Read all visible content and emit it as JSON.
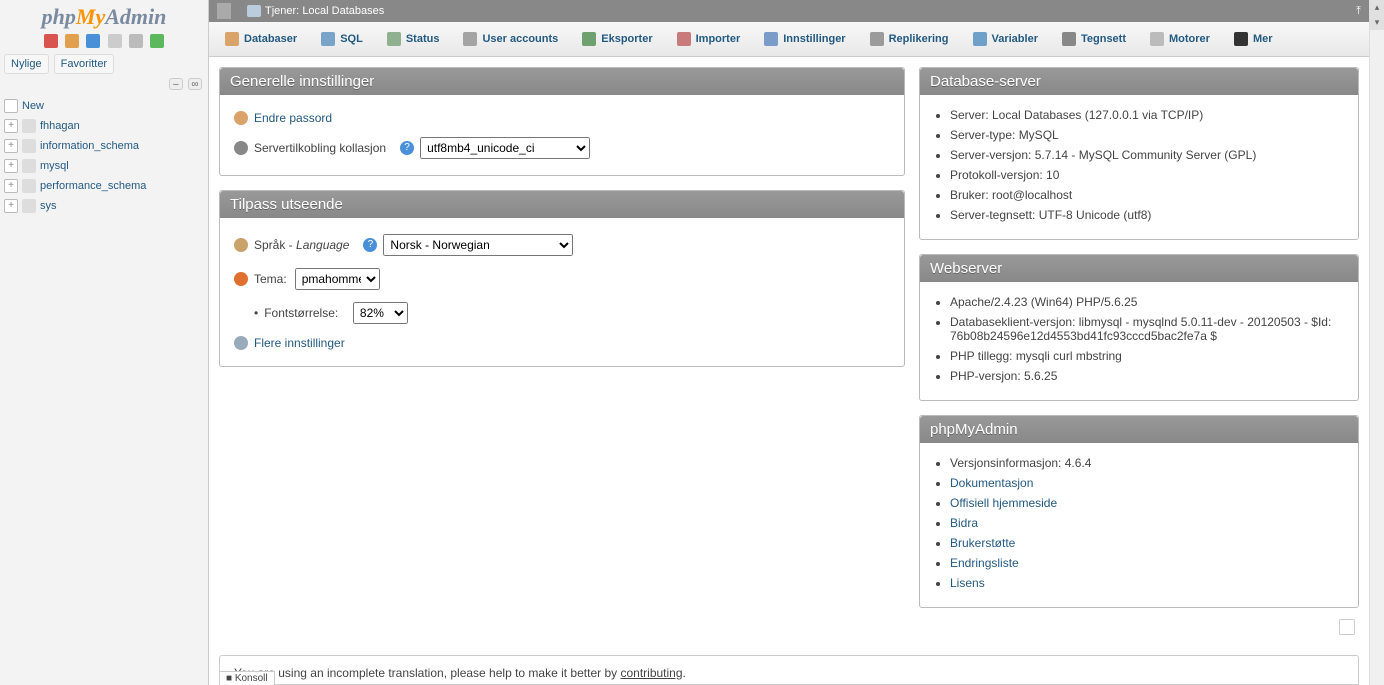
{
  "logo": {
    "p1": "php",
    "p2": "My",
    "p3": "Admin"
  },
  "navTabs": {
    "recent": "Nylige",
    "fav": "Favoritter"
  },
  "tree": {
    "new": "New",
    "dbs": [
      "fhhagan",
      "information_schema",
      "mysql",
      "performance_schema",
      "sys"
    ]
  },
  "crumb": {
    "prefix": "Tjener:",
    "server": "Local Databases"
  },
  "topmenu": [
    {
      "label": "Databaser",
      "color": "#d9a36a"
    },
    {
      "label": "SQL",
      "color": "#7aa3c9"
    },
    {
      "label": "Status",
      "color": "#8fb18f"
    },
    {
      "label": "User accounts",
      "color": "#a4a4a4"
    },
    {
      "label": "Eksporter",
      "color": "#6fa06f"
    },
    {
      "label": "Importer",
      "color": "#c97a7a"
    },
    {
      "label": "Innstillinger",
      "color": "#7a9cc9"
    },
    {
      "label": "Replikering",
      "color": "#9b9b9b"
    },
    {
      "label": "Variabler",
      "color": "#6fa0c9"
    },
    {
      "label": "Tegnsett",
      "color": "#888"
    },
    {
      "label": "Motorer",
      "color": "#bbb"
    },
    {
      "label": "Mer",
      "color": "#333"
    }
  ],
  "panels": {
    "general": {
      "title": "Generelle innstillinger",
      "changePw": "Endre passord",
      "collationLabel": "Servertilkobling kollasjon",
      "collationValue": "utf8mb4_unicode_ci"
    },
    "appearance": {
      "title": "Tilpass utseende",
      "langLabel": "Språk - ",
      "langLabelEm": "Language",
      "langValue": "Norsk - Norwegian",
      "themeLabel": "Tema:",
      "themeValue": "pmahomme",
      "fontLabel": "Fontstørrelse:",
      "fontValue": "82%",
      "more": "Flere innstillinger"
    },
    "dbserver": {
      "title": "Database-server",
      "items": [
        "Server: Local Databases (127.0.0.1 via TCP/IP)",
        "Server-type: MySQL",
        "Server-versjon: 5.7.14 - MySQL Community Server (GPL)",
        "Protokoll-versjon: 10",
        "Bruker: root@localhost",
        "Server-tegnsett: UTF-8 Unicode (utf8)"
      ]
    },
    "webserver": {
      "title": "Webserver",
      "items": [
        "Apache/2.4.23 (Win64) PHP/5.6.25",
        "Databaseklient-versjon: libmysql - mysqlnd 5.0.11-dev - 20120503 - $Id: 76b08b24596e12d4553bd41fc93cccd5bac2fe7a $",
        "PHP tillegg: mysqli  curl  mbstring",
        "PHP-versjon: 5.6.25"
      ]
    },
    "pma": {
      "title": "phpMyAdmin",
      "version": "Versjonsinformasjon: 4.6.4",
      "links": [
        "Dokumentasjon",
        "Offisiell hjemmeside",
        "Bidra",
        "Brukerstøtte",
        "Endringsliste",
        "Lisens"
      ]
    }
  },
  "notice": {
    "text": "You are using an incomplete translation, please help to make it better by ",
    "link": "contributing"
  },
  "console": "Konsoll",
  "navIconColors": [
    "#d9534f",
    "#e0a050",
    "#4a90d9",
    "#ccc",
    "#bbb",
    "#5cb85c"
  ]
}
